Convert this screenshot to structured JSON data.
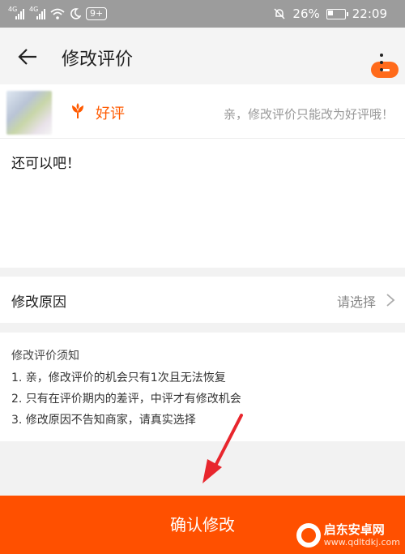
{
  "status_bar": {
    "signal_1_label": "4G",
    "signal_2_label": "4G",
    "badge": "9+",
    "battery_percent": "26%",
    "time": "22:09"
  },
  "app_bar": {
    "title": "修改评价"
  },
  "product": {
    "rating_label": "好评",
    "hint": "亲，修改评价只能改为好评哦！"
  },
  "comment": {
    "text": "还可以吧！"
  },
  "reason": {
    "label": "修改原因",
    "value": "请选择"
  },
  "notice": {
    "title": "修改评价须知",
    "lines": [
      "1. 亲，修改评价的机会只有1次且无法恢复",
      "2. 只有在评价期内的差评，中评才有修改机会",
      "3. 修改原因不告知商家，请真实选择"
    ]
  },
  "confirm_button": {
    "label": "确认修改"
  },
  "watermark": {
    "name": "启东安卓网",
    "url": "www.qdltdkj.com"
  },
  "colors": {
    "accent": "#ff5000",
    "status_bar": "#9c9c9c",
    "annotation_arrow": "#e8262d"
  },
  "icons": [
    "signal-icon",
    "wifi-icon",
    "moon-icon",
    "mute-bell-icon",
    "battery-icon",
    "back-arrow-icon",
    "more-vertical-icon",
    "flower-icon",
    "chevron-right-icon"
  ]
}
